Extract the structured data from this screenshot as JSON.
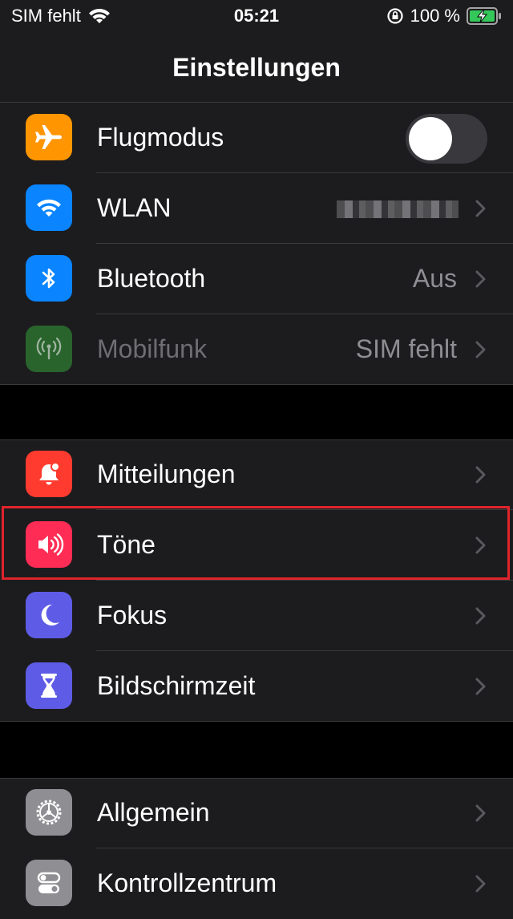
{
  "status_bar": {
    "carrier": "SIM fehlt",
    "time": "05:21",
    "battery_percent": "100 %"
  },
  "nav": {
    "title": "Einstellungen"
  },
  "groups": [
    {
      "rows": [
        {
          "label": "Flugmodus",
          "icon": "airplane-icon",
          "color": "#ff9500",
          "toggle": false
        },
        {
          "label": "WLAN",
          "icon": "wifi-icon",
          "color": "#0a84ff",
          "value": ""
        },
        {
          "label": "Bluetooth",
          "icon": "bluetooth-icon",
          "color": "#0a84ff",
          "value": "Aus"
        },
        {
          "label": "Mobilfunk",
          "icon": "antenna-icon",
          "color": "#2e7d32",
          "value": "SIM fehlt",
          "disabled": true
        }
      ]
    },
    {
      "rows": [
        {
          "label": "Mitteilungen",
          "icon": "notification-bell-icon",
          "color": "#ff3b30"
        },
        {
          "label": "Töne",
          "icon": "speaker-icon",
          "color": "#ff2d55",
          "highlighted": true
        },
        {
          "label": "Fokus",
          "icon": "moon-icon",
          "color": "#5e5ce6"
        },
        {
          "label": "Bildschirmzeit",
          "icon": "hourglass-icon",
          "color": "#5e5ce6"
        }
      ]
    },
    {
      "rows": [
        {
          "label": "Allgemein",
          "icon": "gear-icon",
          "color": "#8e8e93"
        },
        {
          "label": "Kontrollzentrum",
          "icon": "control-switches-icon",
          "color": "#8e8e93"
        }
      ]
    }
  ]
}
